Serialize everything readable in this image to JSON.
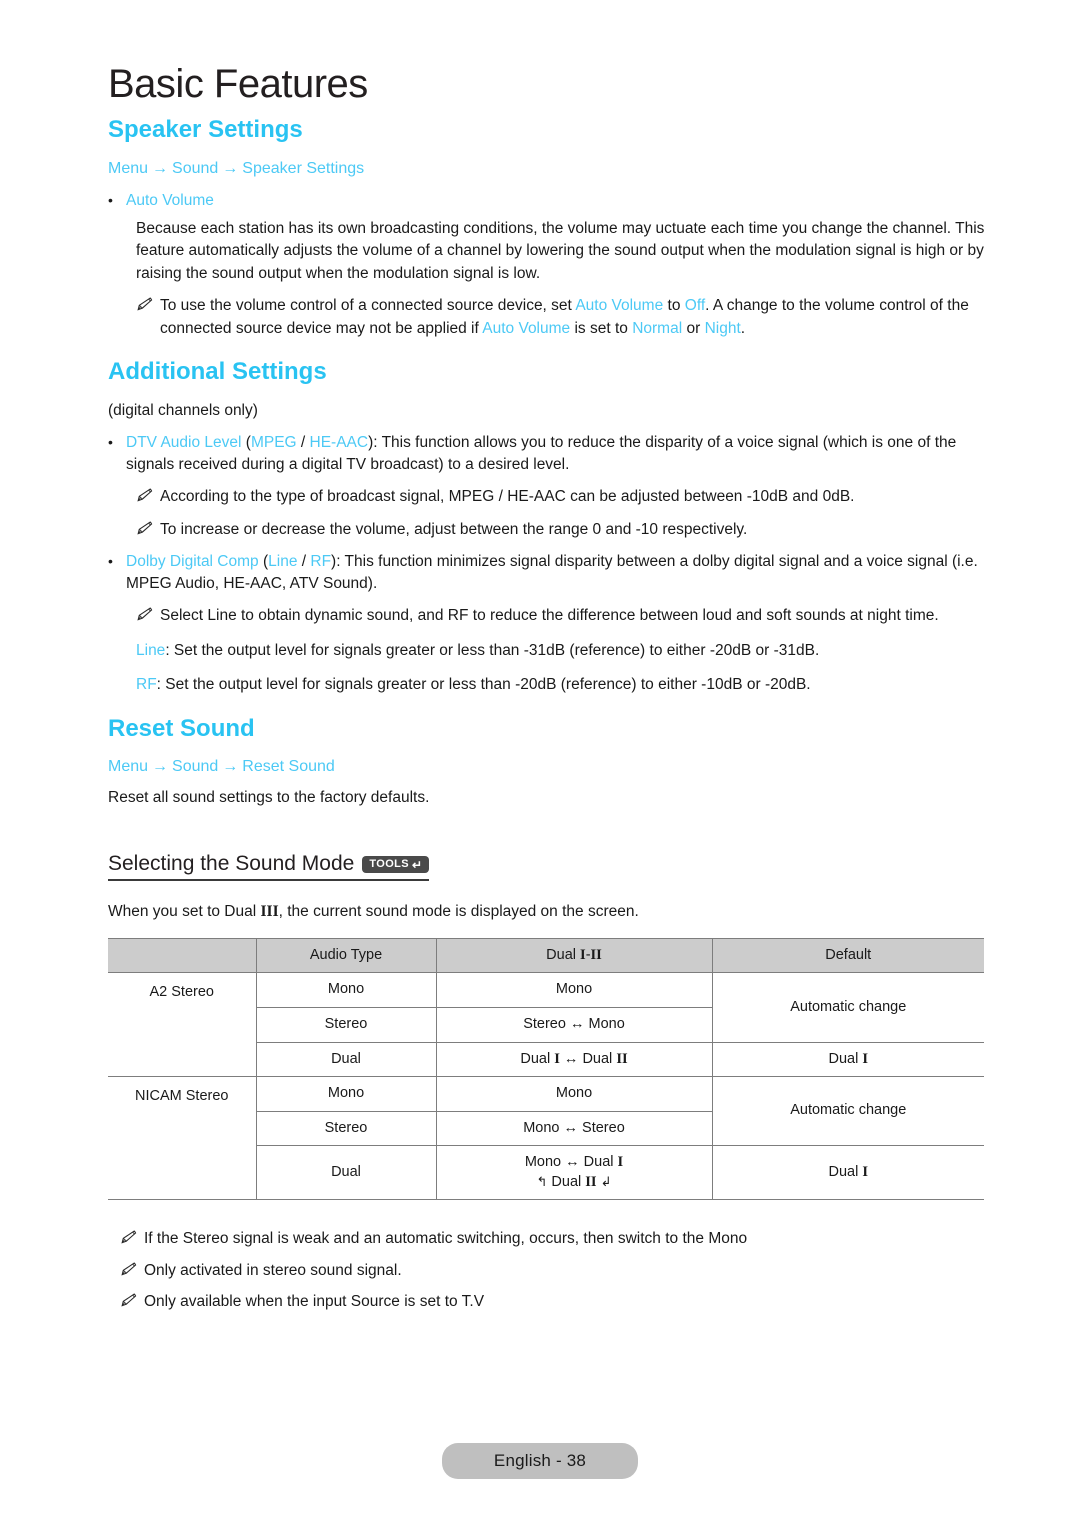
{
  "page": {
    "chapter_title": "Basic Features",
    "footer_label": "English - 38"
  },
  "speaker_settings": {
    "heading": "Speaker Settings",
    "breadcrumb": {
      "items": [
        "Menu",
        "Sound",
        "Speaker Settings"
      ],
      "arrow": "→"
    },
    "bullet_label": "Auto Volume",
    "paragraph": "Because each station has its own broadcasting conditions, the volume may  uctuate each time you change the channel. This feature automatically adjusts the volume of a channel by lowering the sound output when the modulation signal is high or by raising the sound output when the modulation signal is low.",
    "note": {
      "part1": "To use the volume control of a connected source device, set ",
      "auto_volume_1": "Auto Volume",
      "part2": " to ",
      "off": "Off",
      "part3": ". A change to the volume control of the connected source device may not be applied if ",
      "auto_volume_2": "Auto Volume",
      "part4": " is set to ",
      "normal": "Normal",
      "part5": " or ",
      "night": "Night",
      "part6": "."
    }
  },
  "additional_settings": {
    "heading": "Additional Settings",
    "subnote": "(digital channels only)",
    "dtv_audio_level": {
      "label": "DTV Audio Level",
      "open_paren": " (",
      "opt1": "MPEG",
      "slash": " / ",
      "opt2": "HE-AAC",
      "close_paren": "): ",
      "body": "This function allows you to reduce the disparity of a voice signal (which is one of the signals received during a digital TV broadcast) to a desired level."
    },
    "note_mpeg": "According to the type of broadcast signal, MPEG / HE-AAC can be adjusted between -10dB and 0dB.",
    "note_volume": "To increase or decrease the volume, adjust between the range 0 and -10 respectively.",
    "dolby_digital_comp": {
      "label": "Dolby Digital Comp",
      "open_paren": " (",
      "opt1": "Line",
      "slash": " / ",
      "opt2": "RF",
      "close_paren": "): ",
      "body": "This function minimizes signal disparity between a dolby digital signal and a voice signal (i.e. MPEG Audio, HE-AAC, ATV Sound)."
    },
    "note_select_line": "Select Line to obtain dynamic sound, and RF to reduce the difference between loud and soft sounds at night time.",
    "line_def": {
      "label": "Line",
      "body": ": Set the output level for signals greater or less than -31dB (reference) to either -20dB or -31dB."
    },
    "rf_def": {
      "label": "RF",
      "body": ": Set the output level for signals greater or less than -20dB (reference) to either -10dB or -20dB."
    }
  },
  "reset_sound": {
    "heading": "Reset Sound",
    "breadcrumb": {
      "items": [
        "Menu",
        "Sound",
        "Reset Sound"
      ],
      "arrow": "→"
    },
    "body": "Reset all sound settings to the factory defaults."
  },
  "sound_mode": {
    "subheading": "Selecting the Sound Mode",
    "tools_badge": {
      "label": "TOOLS",
      "icon": "enter-arrow-icon",
      "glyph": "↵"
    },
    "intro": {
      "part1": "When you set to Dual ",
      "roman": "I",
      "roman2": "II",
      "part2": ", the current sound mode is displayed on the screen."
    },
    "table": {
      "headers": [
        "",
        "Audio Type",
        "Dual I-II",
        "Default"
      ],
      "header_dual_prefix": "Dual ",
      "header_dual_roman1": "I",
      "header_dual_sep": "-",
      "header_dual_roman2": "II",
      "groups": [
        {
          "name": "A2 Stereo",
          "rows": [
            {
              "audio_type": "Mono",
              "dual": "Mono",
              "default": "Automatic change"
            },
            {
              "audio_type": "Stereo",
              "dual": "Stereo ↔ Mono",
              "default": ""
            },
            {
              "audio_type": "Dual",
              "dual": "Dual I ↔ Dual II",
              "default": "Dual I"
            }
          ]
        },
        {
          "name": "NICAM Stereo",
          "rows": [
            {
              "audio_type": "Mono",
              "dual": "Mono",
              "default": "Automatic change"
            },
            {
              "audio_type": "Stereo",
              "dual": "Mono ↔ Stereo",
              "default": ""
            },
            {
              "audio_type": "Dual",
              "dual": "Mono ↔ Dual I",
              "dual_line2": "↖ Dual II ↙",
              "default": "Dual I"
            }
          ]
        }
      ]
    },
    "footnotes": [
      "If the Stereo signal is weak and an automatic switching, occurs, then switch to the Mono",
      "Only activated in stereo sound signal.",
      "Only available when the input Source is set to T.V"
    ]
  },
  "colors": {
    "accent_cyan": "#4cc9f5",
    "heading_cyan": "#29c3f2",
    "table_header_gray": "#cccccc",
    "footer_pill_gray": "#bfbfbf",
    "badge_gray": "#4a4a4a"
  }
}
